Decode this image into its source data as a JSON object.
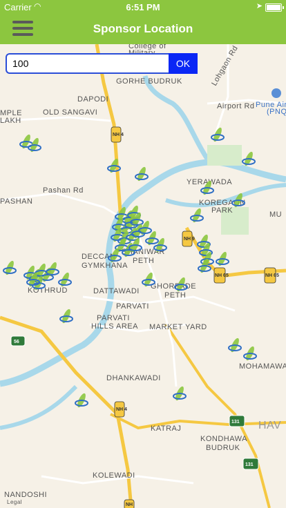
{
  "status_bar": {
    "carrier": "Carrier",
    "time": "6:51 PM"
  },
  "nav": {
    "title": "Sponsor Location"
  },
  "search": {
    "value": "100",
    "ok_label": "OK"
  },
  "map": {
    "place_labels": [
      "College of",
      "Military",
      "GORHE BUDRUK",
      "Lohgaon Rd",
      "DAPODI",
      "Airport Rd",
      "Pune Airport",
      "(PNQ)",
      "MPLE",
      "LAKH",
      "OLD SANGAVI",
      "PASHAN",
      "Pashan Rd",
      "YERAWADA",
      "KOREGAON",
      "PARK",
      "MU",
      "DECCAN",
      "GYMKHANA",
      "SHANIWAR",
      "PETH",
      "KOTHRUD",
      "DATTAWADI",
      "GHORPADE",
      "PETH",
      "PARVATI",
      "PARVATI",
      "HILLS AREA",
      "MARKET YARD",
      "MOHAMAWA",
      "DHANKAWADI",
      "KATRAJ",
      "KONDHAWA",
      "BUDRUK",
      "HAV",
      "KOLEWADI",
      "NANDOSHI",
      "Legal"
    ],
    "road_shields": [
      "NH 4",
      "NH 9",
      "NH 65",
      "NH 65",
      "56",
      "NH 4",
      "131",
      "131",
      "NH"
    ],
    "marker_color_primary": "#8cc63f",
    "marker_color_secondary": "#2f6fc4",
    "marker_icon": "sponsor-leaf-marker-icon"
  }
}
